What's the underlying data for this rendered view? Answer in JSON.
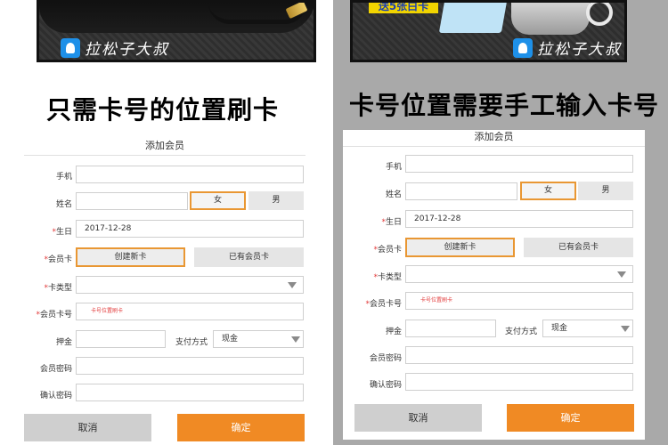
{
  "banners": {
    "left": {
      "logo_text": "拉松子大叔"
    },
    "right": {
      "promo_text": "送5张白卡",
      "logo_text": "拉松子大叔"
    }
  },
  "headings": {
    "left": "只需卡号的位置刷卡",
    "right": "卡号位置需要手工输入卡号"
  },
  "form_left": {
    "title": "添加会员",
    "phone_label": "手机",
    "name_label": "姓名",
    "gender_female": "女",
    "gender_male": "男",
    "birthday_label": "生日",
    "birthday_value": "2017-12-28",
    "member_card_label": "会员卡",
    "create_card_btn": "创建新卡",
    "existing_card_btn": "已有会员卡",
    "card_type_label": "卡类型",
    "card_number_label": "会员卡号",
    "card_number_hint": "卡号位置刷卡",
    "deposit_label": "押金",
    "payment_method_label": "支付方式",
    "payment_method_value": "现金",
    "password_label": "会员密码",
    "confirm_password_label": "确认密码",
    "cancel_btn": "取消",
    "confirm_btn": "确定",
    "required_mark": "*"
  },
  "form_right": {
    "title": "添加会员",
    "phone_label": "手机",
    "name_label": "姓名",
    "gender_female": "女",
    "gender_male": "男",
    "birthday_label": "生日",
    "birthday_value": "2017-12-28",
    "member_card_label": "会员卡",
    "create_card_btn": "创建新卡",
    "existing_card_btn": "已有会员卡",
    "card_type_label": "卡类型",
    "card_number_label": "会员卡号",
    "card_number_hint": "卡号位置刷卡",
    "deposit_label": "押金",
    "payment_method_label": "支付方式",
    "payment_method_value": "现金",
    "password_label": "会员密码",
    "confirm_password_label": "确认密码",
    "cancel_btn": "取消",
    "confirm_btn": "确定",
    "required_mark": "*"
  },
  "colors": {
    "accent_orange": "#f08a24",
    "active_border": "#e99733",
    "required_red": "#e23a3a",
    "right_background": "#a9a9a9"
  }
}
